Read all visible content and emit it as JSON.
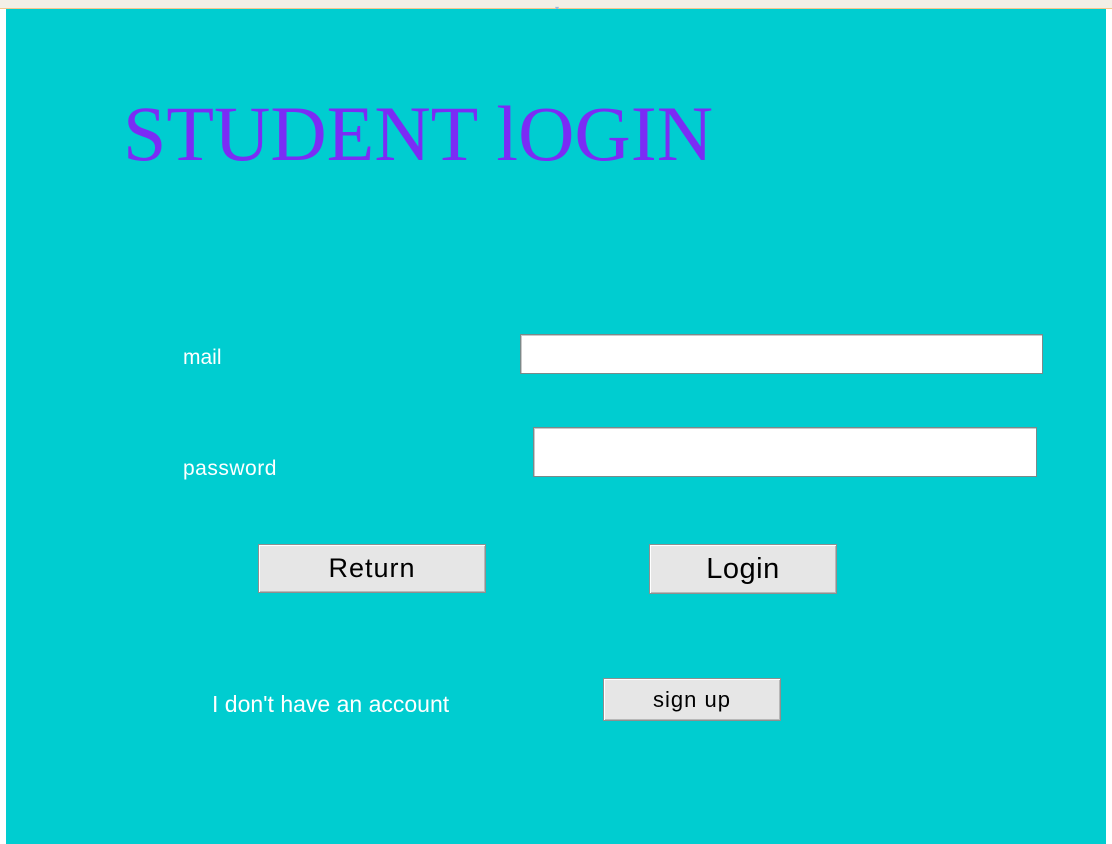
{
  "window": {
    "background_color": "#00cdd0",
    "title_color": "#7b2cf5",
    "label_color": "#ffffff"
  },
  "header": {
    "title": "STUDENT lOGIN"
  },
  "form": {
    "mail_label": "mail",
    "mail_value": "",
    "password_label": "password",
    "password_value": ""
  },
  "actions": {
    "return_label": "Return",
    "login_label": "Login"
  },
  "signup": {
    "prompt": "I don't have an account",
    "button_label": "sign up"
  }
}
